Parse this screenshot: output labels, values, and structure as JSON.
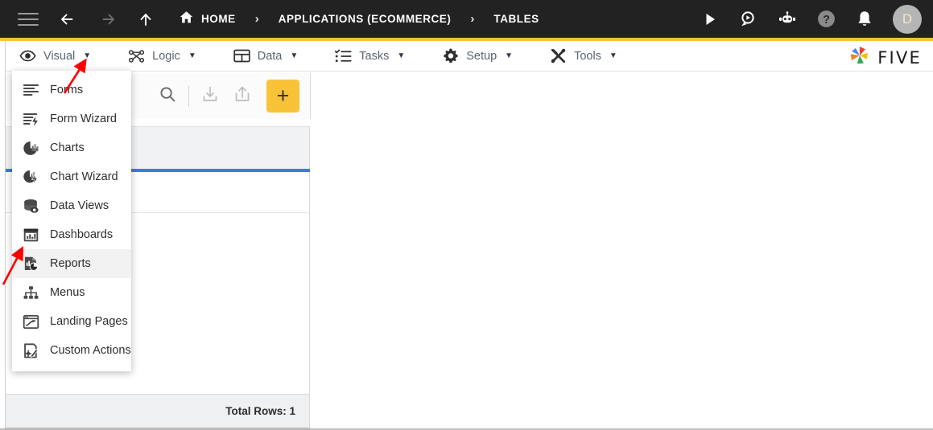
{
  "header": {
    "nav_icons": [
      {
        "name": "hamburger-menu-icon",
        "label": "Menu"
      },
      {
        "name": "back-arrow-icon",
        "label": "Back"
      },
      {
        "name": "forward-arrow-icon",
        "label": "Forward"
      },
      {
        "name": "up-arrow-icon",
        "label": "Up"
      }
    ],
    "breadcrumb": [
      {
        "label": "HOME",
        "icon": "home-icon"
      },
      {
        "label": "APPLICATIONS (ECOMMERCE)",
        "icon": ""
      },
      {
        "label": "TABLES",
        "icon": ""
      }
    ],
    "separator": "›",
    "right_icons": [
      {
        "name": "run-play-icon",
        "label": "Run"
      },
      {
        "name": "chat-search-icon",
        "label": "Search Chat"
      },
      {
        "name": "robot-assistant-icon",
        "label": "AI Assistant"
      },
      {
        "name": "help-icon",
        "label": "Help"
      },
      {
        "name": "notifications-bell-icon",
        "label": "Notifications"
      }
    ],
    "avatar_initial": "D",
    "background_color": "#222222",
    "accent_color": "#F5C33B"
  },
  "menubar": {
    "items": [
      {
        "label": "Visual",
        "icon": "eye-icon",
        "caret": "▼",
        "active": true
      },
      {
        "label": "Logic",
        "icon": "logic-nodes-icon",
        "caret": "▼",
        "active": false
      },
      {
        "label": "Data",
        "icon": "table-grid-icon",
        "caret": "▼",
        "active": false
      },
      {
        "label": "Tasks",
        "icon": "checklist-icon",
        "caret": "▼",
        "active": false
      },
      {
        "label": "Setup",
        "icon": "gear-icon",
        "caret": "▼",
        "active": false
      },
      {
        "label": "Tools",
        "icon": "wrench-screwdriver-icon",
        "caret": "▼",
        "active": false
      }
    ]
  },
  "brand": {
    "name": "FIVE",
    "logo_icon": "five-pinwheel-logo-icon",
    "logo_colors": [
      "#4285F4",
      "#EA4335",
      "#FBBC05",
      "#34A853",
      "#F4811F"
    ]
  },
  "visual_dropdown": {
    "open": true,
    "items": [
      {
        "label": "Forms",
        "icon": "forms-lines-icon",
        "active": false
      },
      {
        "label": "Form Wizard",
        "icon": "form-wizard-bolt-icon",
        "active": false
      },
      {
        "label": "Charts",
        "icon": "charts-pie-icon",
        "active": false
      },
      {
        "label": "Chart Wizard",
        "icon": "chart-wizard-bolt-icon",
        "active": false
      },
      {
        "label": "Data Views",
        "icon": "data-views-database-icon",
        "active": false
      },
      {
        "label": "Dashboards",
        "icon": "dashboards-window-icon",
        "active": false
      },
      {
        "label": "Reports",
        "icon": "reports-document-pie-icon",
        "active": true
      },
      {
        "label": "Menus",
        "icon": "menus-hierarchy-icon",
        "active": false
      },
      {
        "label": "Landing Pages",
        "icon": "landing-pages-icon",
        "active": false
      },
      {
        "label": "Custom Actions",
        "icon": "custom-actions-pencil-icon",
        "active": false
      }
    ]
  },
  "toolbar": {
    "buttons": [
      {
        "name": "search-button",
        "icon": "search-icon",
        "label": "Search"
      },
      {
        "name": "import-button",
        "icon": "import-download-icon",
        "label": "Import"
      },
      {
        "name": "export-button",
        "icon": "export-upload-icon",
        "label": "Export"
      },
      {
        "name": "add-button",
        "icon": "plus-icon",
        "label": "+",
        "color": "#F8C339"
      }
    ],
    "add_symbol": "+"
  },
  "grid": {
    "header_underline_color": "#3B7DD8",
    "columns": [],
    "rows": []
  },
  "statusbar": {
    "total_rows_label": "Total Rows: 1"
  },
  "annotations": [
    {
      "name": "arrow-pointing-to-visual-menu",
      "color": "#FF0000",
      "target": "Visual"
    },
    {
      "name": "arrow-pointing-to-reports-item",
      "color": "#FF0000",
      "target": "Reports"
    }
  ]
}
